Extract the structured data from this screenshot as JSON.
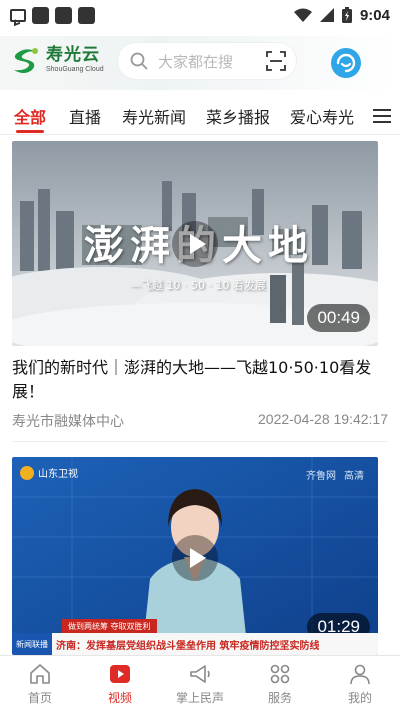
{
  "status_bar": {
    "time": "9:04"
  },
  "header": {
    "logo_cn": "寿光云",
    "logo_en": "ShouGuang Cloud",
    "search_placeholder": "大家都在搜"
  },
  "tabs": [
    {
      "label": "全部",
      "active": true
    },
    {
      "label": "直播"
    },
    {
      "label": "寿光新闻"
    },
    {
      "label": "菜乡播报"
    },
    {
      "label": "爱心寿光"
    }
  ],
  "feed": [
    {
      "thumb_title": "澎湃的大地",
      "thumb_subtitle": "—飞越 10 · 50 · 10 看发展",
      "duration": "00:49",
      "title": "我们的新时代｜澎湃的大地——飞越10·50·10看发展！",
      "source": "寿光市融媒体中心",
      "date": "2022-04-28 19:42:17"
    },
    {
      "channel": "山东卫视",
      "watermark": "齐鲁网",
      "hd": "高清",
      "ticker_tag": "新闻联播",
      "ticker_upper": "做到两统筹 夺取双胜利",
      "ticker_text": "济南：发挥基层党组织战斗堡垒作用  筑牢疫情防控坚实防线",
      "duration": "01:29"
    }
  ],
  "bottom_nav": [
    {
      "label": "首页",
      "icon": "home-icon"
    },
    {
      "label": "视频",
      "icon": "video-icon",
      "active": true
    },
    {
      "label": "掌上民声",
      "icon": "megaphone-icon"
    },
    {
      "label": "服务",
      "icon": "grid-icon"
    },
    {
      "label": "我的",
      "icon": "person-icon"
    }
  ],
  "colors": {
    "accent": "#e02a26",
    "brand_green": "#1f7a3a",
    "brand_blue": "#2ea6e8"
  }
}
